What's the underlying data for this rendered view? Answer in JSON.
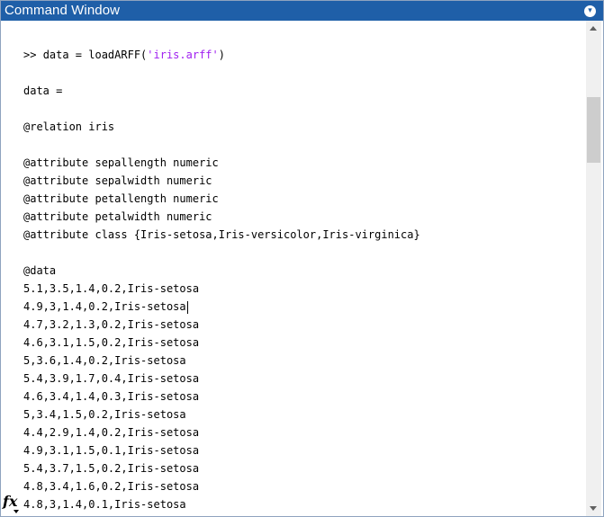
{
  "window": {
    "title": "Command Window",
    "menu_icon": "chevron-down-circle-icon",
    "accent_color": "#1f5fa8"
  },
  "command": {
    "prompt": ">> ",
    "code": "data = loadARFF(",
    "string_arg": "'iris.arff'",
    "close": ")",
    "string_color": "#a020f0"
  },
  "output": {
    "blank_after_command": "",
    "var_assign": "data =",
    "blank1": "",
    "relation": "@relation iris",
    "blank2": "",
    "attributes": [
      "@attribute sepallength numeric",
      "@attribute sepalwidth numeric",
      "@attribute petallength numeric",
      "@attribute petalwidth numeric",
      "@attribute class {Iris-setosa,Iris-versicolor,Iris-virginica}"
    ],
    "blank3": "",
    "data_header": "@data",
    "rows": [
      "5.1,3.5,1.4,0.2,Iris-setosa",
      "4.9,3,1.4,0.2,Iris-setosa",
      "4.7,3.2,1.3,0.2,Iris-setosa",
      "4.6,3.1,1.5,0.2,Iris-setosa",
      "5,3.6,1.4,0.2,Iris-setosa",
      "5.4,3.9,1.7,0.4,Iris-setosa",
      "4.6,3.4,1.4,0.3,Iris-setosa",
      "5,3.4,1.5,0.2,Iris-setosa",
      "4.4,2.9,1.4,0.2,Iris-setosa",
      "4.9,3.1,1.5,0.1,Iris-setosa",
      "5.4,3.7,1.5,0.2,Iris-setosa",
      "4.8,3.4,1.6,0.2,Iris-setosa",
      "4.8,3,1.4,0.1,Iris-setosa"
    ]
  },
  "function_browser": {
    "label": "fx",
    "icon": "function-browser-icon"
  },
  "scrollbar": {
    "icons": [
      "scroll-up-arrow-icon",
      "scroll-down-arrow-icon"
    ]
  }
}
